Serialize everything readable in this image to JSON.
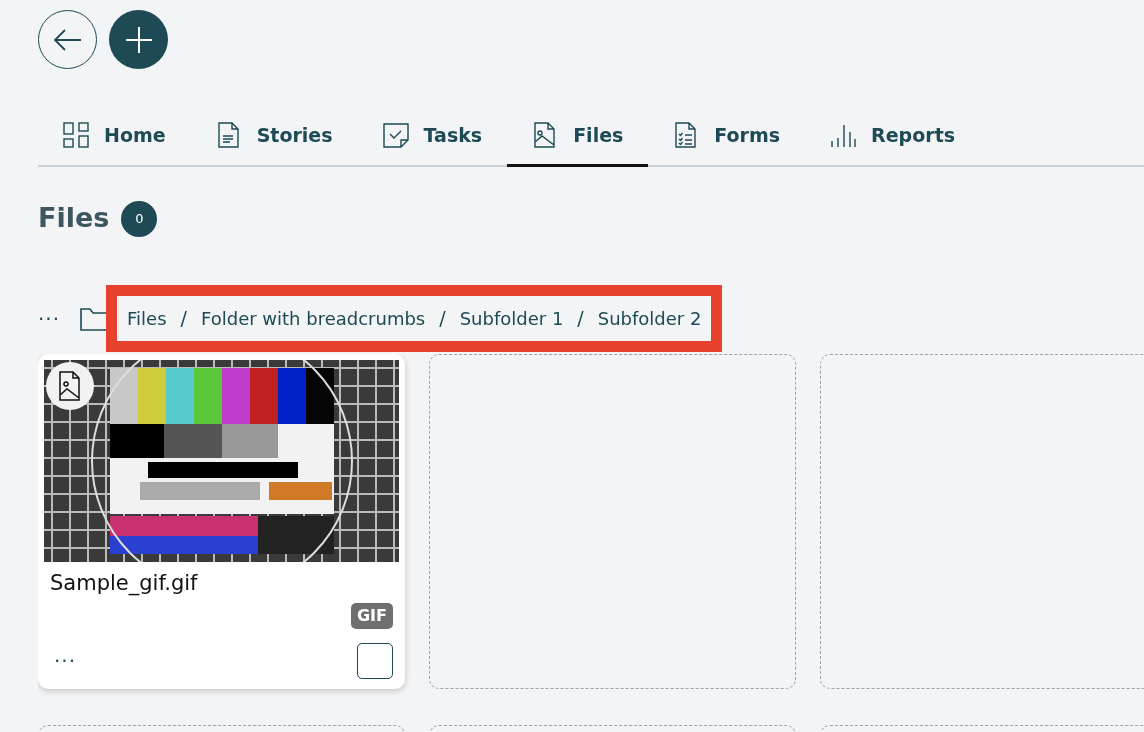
{
  "tabs": [
    {
      "label": "Home",
      "kind": "grid",
      "selected": false
    },
    {
      "label": "Stories",
      "kind": "document",
      "selected": false
    },
    {
      "label": "Tasks",
      "kind": "task",
      "selected": false
    },
    {
      "label": "Files",
      "kind": "image",
      "selected": true
    },
    {
      "label": "Forms",
      "kind": "form",
      "selected": false
    },
    {
      "label": "Reports",
      "kind": "chart",
      "selected": false
    }
  ],
  "heading": {
    "title": "Files",
    "count": "0"
  },
  "breadcrumb": {
    "more": "···",
    "items": [
      {
        "kind": "link",
        "text": "Files"
      },
      {
        "kind": "separator",
        "text": "/"
      },
      {
        "kind": "link",
        "text": "Folder with breadcrumbs"
      },
      {
        "kind": "separator",
        "text": "/"
      },
      {
        "kind": "link",
        "text": "Subfolder 1"
      },
      {
        "kind": "separator",
        "text": "/"
      },
      {
        "kind": "link",
        "text": "Subfolder 2"
      }
    ]
  },
  "cards": [
    {
      "kind": "file",
      "name": "Sample_gif.gif",
      "type": "GIF",
      "more": "···",
      "checked": false
    },
    {
      "kind": "empty"
    },
    {
      "kind": "empty"
    },
    {
      "kind": "empty"
    },
    {
      "kind": "empty"
    },
    {
      "kind": "empty"
    }
  ]
}
